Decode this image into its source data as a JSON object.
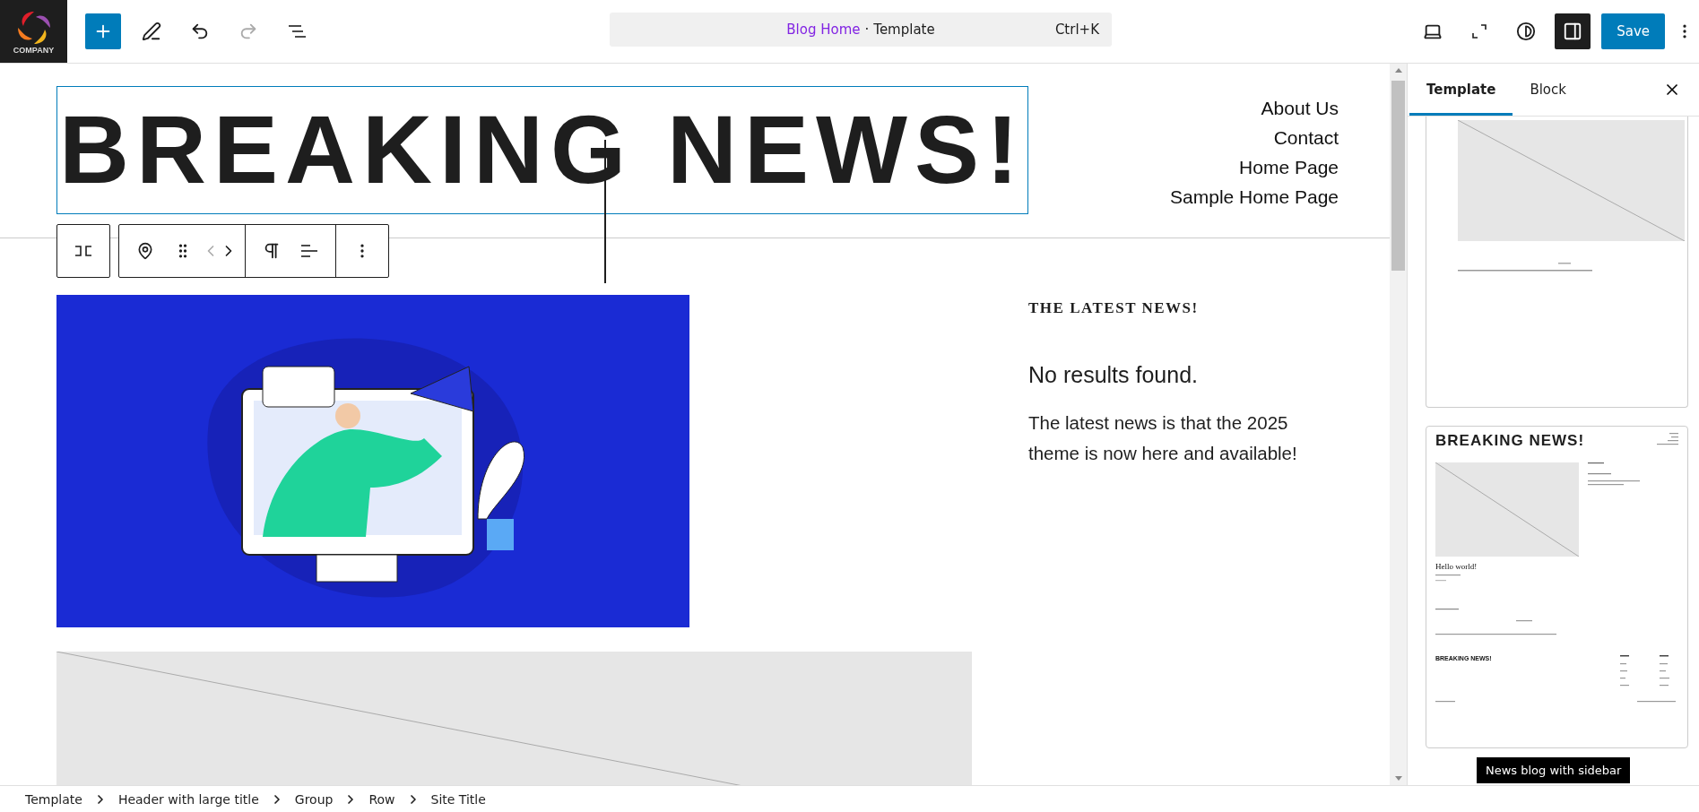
{
  "logo": {
    "text": "COMPANY"
  },
  "toolbar": {
    "redo_disabled": true
  },
  "command_bar": {
    "link": "Blog Home",
    "separator": "·",
    "label": "Template",
    "shortcut": "Ctrl+K"
  },
  "actions": {
    "sidebar_open": true,
    "save": "Save"
  },
  "canvas": {
    "site_title": "BREAKING NEWS!",
    "nav": [
      "About Us",
      "Contact",
      "Home Page",
      "Sample Home Page"
    ],
    "block_toolbar": {
      "move_up_disabled": true
    },
    "sidebar_heading": "THE LATEST NEWS!",
    "no_results": "No results found.",
    "paragraph": "The latest news is that the 2025 theme is now here and available!"
  },
  "sidebar": {
    "tabs": [
      {
        "label": "Template",
        "selected": true
      },
      {
        "label": "Block",
        "selected": false
      }
    ],
    "previews": [
      {
        "kind": "partial"
      },
      {
        "kind": "page",
        "title": "BREAKING NEWS!",
        "post_title": "Hello world!",
        "footer_title": "BREAKING NEWS!"
      }
    ],
    "tooltip": "News blog with sidebar"
  },
  "breadcrumbs": [
    "Template",
    "Header with large title",
    "Group",
    "Row",
    "Site Title"
  ]
}
